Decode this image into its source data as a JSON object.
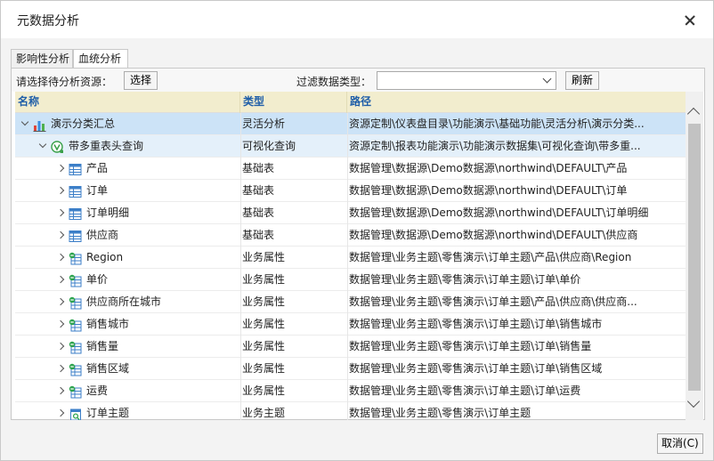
{
  "window": {
    "title": "元数据分析"
  },
  "tabs": [
    {
      "label": "影响性分析",
      "active": false
    },
    {
      "label": "血统分析",
      "active": true
    }
  ],
  "toolbar": {
    "source_label": "请选择待分析资源：",
    "select_button": "选择",
    "filter_label": "过滤数据类型：",
    "filter_value": "",
    "refresh_button": "刷新"
  },
  "grid": {
    "columns": [
      "名称",
      "类型",
      "路径"
    ],
    "rows": [
      {
        "level": 0,
        "expand": "down",
        "icon": "bar-chart-icon",
        "name": "演示分类汇总",
        "type": "灵活分析",
        "path": "资源定制\\仪表盘目录\\功能演示\\基础功能\\灵活分析\\演示分类...",
        "state": "sel1"
      },
      {
        "level": 1,
        "expand": "down",
        "icon": "visual-query-icon",
        "name": "带多重表头查询",
        "type": "可视化查询",
        "path": "资源定制\\报表功能演示\\功能演示数据集\\可视化查询\\带多重...",
        "state": "sel2"
      },
      {
        "level": 2,
        "expand": "right",
        "icon": "table-icon",
        "name": "产品",
        "type": "基础表",
        "path": "数据管理\\数据源\\Demo数据源\\northwind\\DEFAULT\\产品",
        "state": ""
      },
      {
        "level": 2,
        "expand": "right",
        "icon": "table-icon",
        "name": "订单",
        "type": "基础表",
        "path": "数据管理\\数据源\\Demo数据源\\northwind\\DEFAULT\\订单",
        "state": ""
      },
      {
        "level": 2,
        "expand": "right",
        "icon": "table-icon",
        "name": "订单明细",
        "type": "基础表",
        "path": "数据管理\\数据源\\Demo数据源\\northwind\\DEFAULT\\订单明细",
        "state": ""
      },
      {
        "level": 2,
        "expand": "right",
        "icon": "table-icon",
        "name": "供应商",
        "type": "基础表",
        "path": "数据管理\\数据源\\Demo数据源\\northwind\\DEFAULT\\供应商",
        "state": ""
      },
      {
        "level": 2,
        "expand": "right",
        "icon": "attribute-icon",
        "name": "Region",
        "type": "业务属性",
        "path": "数据管理\\业务主题\\零售演示\\订单主题\\产品\\供应商\\Region",
        "state": ""
      },
      {
        "level": 2,
        "expand": "right",
        "icon": "attribute-icon",
        "name": "单价",
        "type": "业务属性",
        "path": "数据管理\\业务主题\\零售演示\\订单主题\\订单\\单价",
        "state": ""
      },
      {
        "level": 2,
        "expand": "right",
        "icon": "attribute-icon",
        "name": "供应商所在城市",
        "type": "业务属性",
        "path": "数据管理\\业务主题\\零售演示\\订单主题\\产品\\供应商\\供应商...",
        "state": ""
      },
      {
        "level": 2,
        "expand": "right",
        "icon": "attribute-icon",
        "name": "销售城市",
        "type": "业务属性",
        "path": "数据管理\\业务主题\\零售演示\\订单主题\\订单\\销售城市",
        "state": ""
      },
      {
        "level": 2,
        "expand": "right",
        "icon": "attribute-icon",
        "name": "销售量",
        "type": "业务属性",
        "path": "数据管理\\业务主题\\零售演示\\订单主题\\订单\\销售量",
        "state": ""
      },
      {
        "level": 2,
        "expand": "right",
        "icon": "attribute-icon",
        "name": "销售区域",
        "type": "业务属性",
        "path": "数据管理\\业务主题\\零售演示\\订单主题\\订单\\销售区域",
        "state": ""
      },
      {
        "level": 2,
        "expand": "right",
        "icon": "attribute-icon",
        "name": "运费",
        "type": "业务属性",
        "path": "数据管理\\业务主题\\零售演示\\订单主题\\订单\\运费",
        "state": ""
      },
      {
        "level": 2,
        "expand": "right",
        "icon": "business-theme-icon",
        "name": "订单主题",
        "type": "业务主题",
        "path": "数据管理\\业务主题\\零售演示\\订单主题",
        "state": ""
      }
    ]
  },
  "footer": {
    "cancel_button": "取消(C)"
  }
}
